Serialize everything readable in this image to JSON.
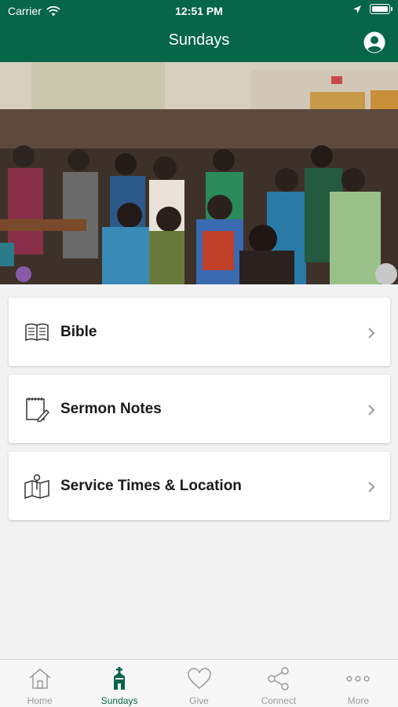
{
  "status_bar": {
    "carrier": "Carrier",
    "time": "12:51 PM"
  },
  "header": {
    "title": "Sundays"
  },
  "menu": [
    {
      "label": "Bible",
      "icon": "book-icon"
    },
    {
      "label": "Sermon Notes",
      "icon": "notepad-icon"
    },
    {
      "label": "Service Times & Location",
      "icon": "map-pin-icon"
    }
  ],
  "tabs": [
    {
      "label": "Home",
      "icon": "home-icon",
      "active": false
    },
    {
      "label": "Sundays",
      "icon": "church-icon",
      "active": true
    },
    {
      "label": "Give",
      "icon": "heart-icon",
      "active": false
    },
    {
      "label": "Connect",
      "icon": "share-icon",
      "active": false
    },
    {
      "label": "More",
      "icon": "more-dots-icon",
      "active": false
    }
  ],
  "colors": {
    "brand": "#07654a",
    "inactive_tab": "#9a9a9a"
  }
}
